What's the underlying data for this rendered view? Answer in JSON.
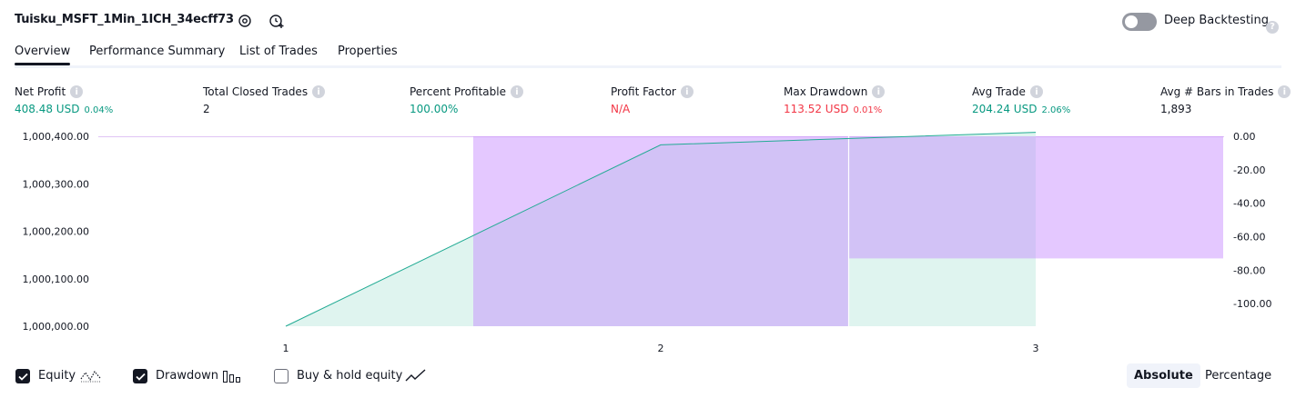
{
  "header": {
    "strategy_name": "Tuisku_MSFT_1Min_1ICH_34ecff73",
    "deep_backtesting_label": "Deep Backtesting",
    "deep_backtesting_enabled": false
  },
  "tabs": [
    {
      "label": "Overview",
      "active": true
    },
    {
      "label": "Performance Summary",
      "active": false
    },
    {
      "label": "List of Trades",
      "active": false
    },
    {
      "label": "Properties",
      "active": false
    }
  ],
  "metrics": [
    {
      "label": "Net Profit",
      "value": "408.48 USD",
      "pct": "0.04%",
      "color": "#089981"
    },
    {
      "label": "Total Closed Trades",
      "value": "2",
      "pct": "",
      "color": "#131722"
    },
    {
      "label": "Percent Profitable",
      "value": "100.00%",
      "pct": "",
      "color": "#089981"
    },
    {
      "label": "Profit Factor",
      "value": "N/A",
      "pct": "",
      "color": "#f23645"
    },
    {
      "label": "Max Drawdown",
      "value": "113.52 USD",
      "pct": "0.01%",
      "color": "#f23645"
    },
    {
      "label": "Avg Trade",
      "value": "204.24 USD",
      "pct": "2.06%",
      "color": "#089981"
    },
    {
      "label": "Avg # Bars in Trades",
      "value": "1,893",
      "pct": "",
      "color": "#131722"
    }
  ],
  "chart_data": {
    "type": "area",
    "x": [
      1,
      2,
      3
    ],
    "x_ticks": [
      "1",
      "2",
      "3"
    ],
    "left_axis": {
      "ticks": [
        "1,000,400.00",
        "1,000,300.00",
        "1,000,200.00",
        "1,000,100.00",
        "1,000,000.00"
      ],
      "range": [
        1000000,
        1000400
      ]
    },
    "right_axis": {
      "ticks": [
        "0.00",
        "-20.00",
        "-40.00",
        "-60.00",
        "-80.00",
        "-100.00"
      ],
      "range": [
        -113.52,
        0
      ]
    },
    "series": [
      {
        "name": "Equity",
        "values": [
          1000000,
          1000382,
          1000408.48
        ],
        "color": "#22ab94"
      },
      {
        "name": "Drawdown",
        "values": [
          0,
          -113.52,
          -73
        ],
        "color": "#c485ff"
      }
    ]
  },
  "legend": [
    {
      "label": "Equity",
      "checked": true,
      "icon": "equity-line-icon"
    },
    {
      "label": "Drawdown",
      "checked": true,
      "icon": "drawdown-bars-icon"
    },
    {
      "label": "Buy & hold equity",
      "checked": false,
      "icon": "buy-hold-line-icon"
    }
  ],
  "view_toggle": {
    "absolute_label": "Absolute",
    "percentage_label": "Percentage",
    "active": "Absolute"
  }
}
